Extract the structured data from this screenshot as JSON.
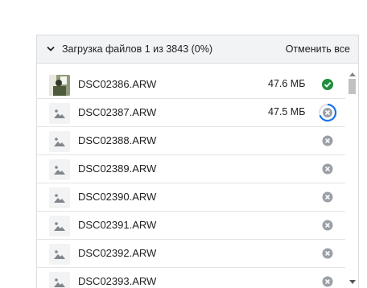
{
  "header": {
    "title": "Загрузка файлов 1 из 3843 (0%)",
    "cancel_all_label": "Отменить все",
    "toggle_icon": "chevron-down-icon"
  },
  "files": [
    {
      "name": "DSC02386.ARW",
      "size": "47.6 МБ",
      "status": "done",
      "thumb": "photo"
    },
    {
      "name": "DSC02387.ARW",
      "size": "47.5 МБ",
      "status": "uploading",
      "thumb": "placeholder"
    },
    {
      "name": "DSC02388.ARW",
      "size": "",
      "status": "queued",
      "thumb": "placeholder"
    },
    {
      "name": "DSC02389.ARW",
      "size": "",
      "status": "queued",
      "thumb": "placeholder"
    },
    {
      "name": "DSC02390.ARW",
      "size": "",
      "status": "queued",
      "thumb": "placeholder"
    },
    {
      "name": "DSC02391.ARW",
      "size": "",
      "status": "queued",
      "thumb": "placeholder"
    },
    {
      "name": "DSC02392.ARW",
      "size": "",
      "status": "queued",
      "thumb": "placeholder"
    },
    {
      "name": "DSC02393.ARW",
      "size": "",
      "status": "queued",
      "thumb": "placeholder"
    }
  ],
  "colors": {
    "done": "#1e8e3e",
    "progress": "#1a73e8",
    "cancel": "#9aa0a6",
    "header_bg": "#f1f3f4"
  }
}
